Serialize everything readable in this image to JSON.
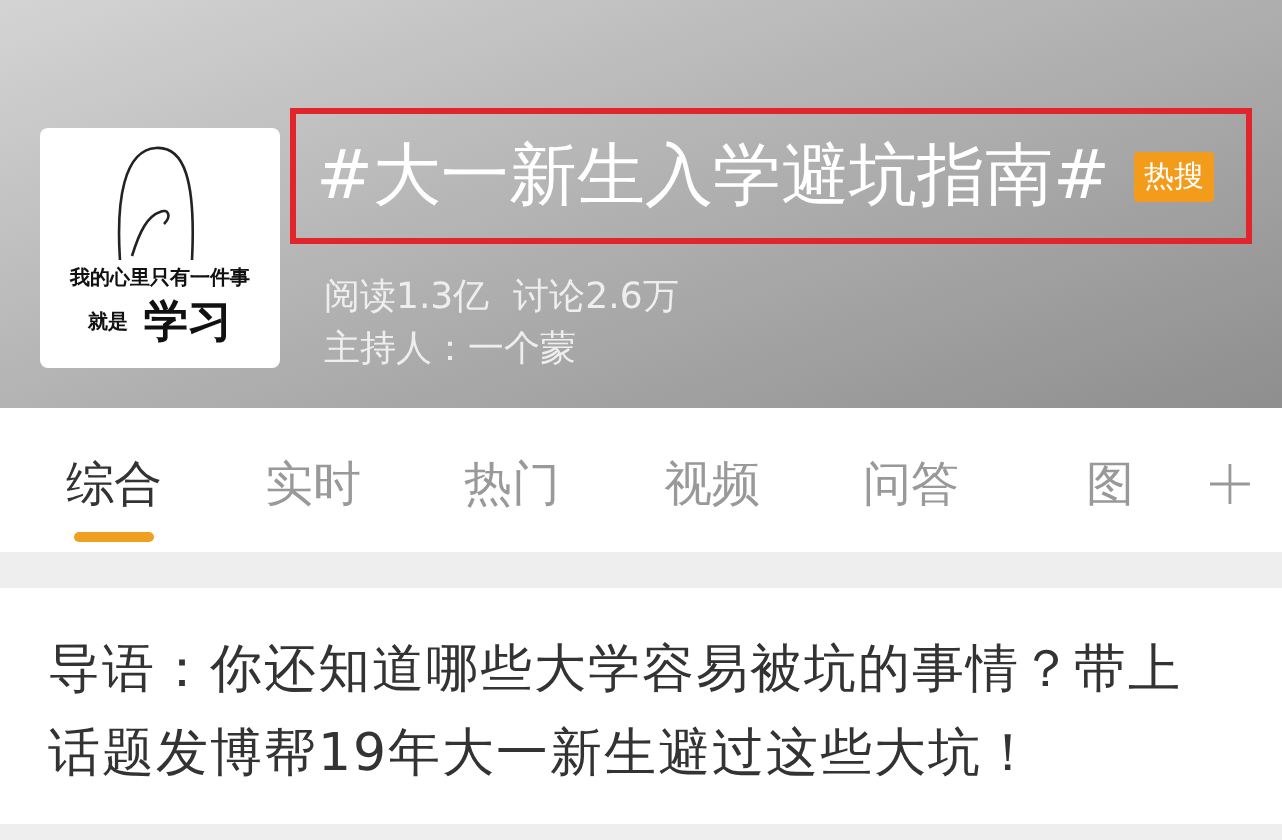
{
  "topic": {
    "title": "#大一新生入学避坑指南#",
    "badge": "热搜",
    "highlighted": true,
    "avatar": {
      "kind": "picture",
      "caption_line_1": "我的心里只有一件事",
      "caption_prefix": "就是",
      "caption_big": "学习"
    },
    "stats": [
      {
        "label": "阅读1.3亿"
      },
      {
        "label": "讨论2.6万"
      }
    ],
    "host": "主持人：一个蒙"
  },
  "tabs": [
    {
      "label": "综合",
      "selected": true
    },
    {
      "label": "实时",
      "selected": false
    },
    {
      "label": "热门",
      "selected": false
    },
    {
      "label": "视频",
      "selected": false
    },
    {
      "label": "问答",
      "selected": false
    },
    {
      "label": "图",
      "selected": false
    }
  ],
  "intro": "导语：你还知道哪些大学容易被坑的事情？带上话题发博帮19年大一新生避过这些大坑！"
}
